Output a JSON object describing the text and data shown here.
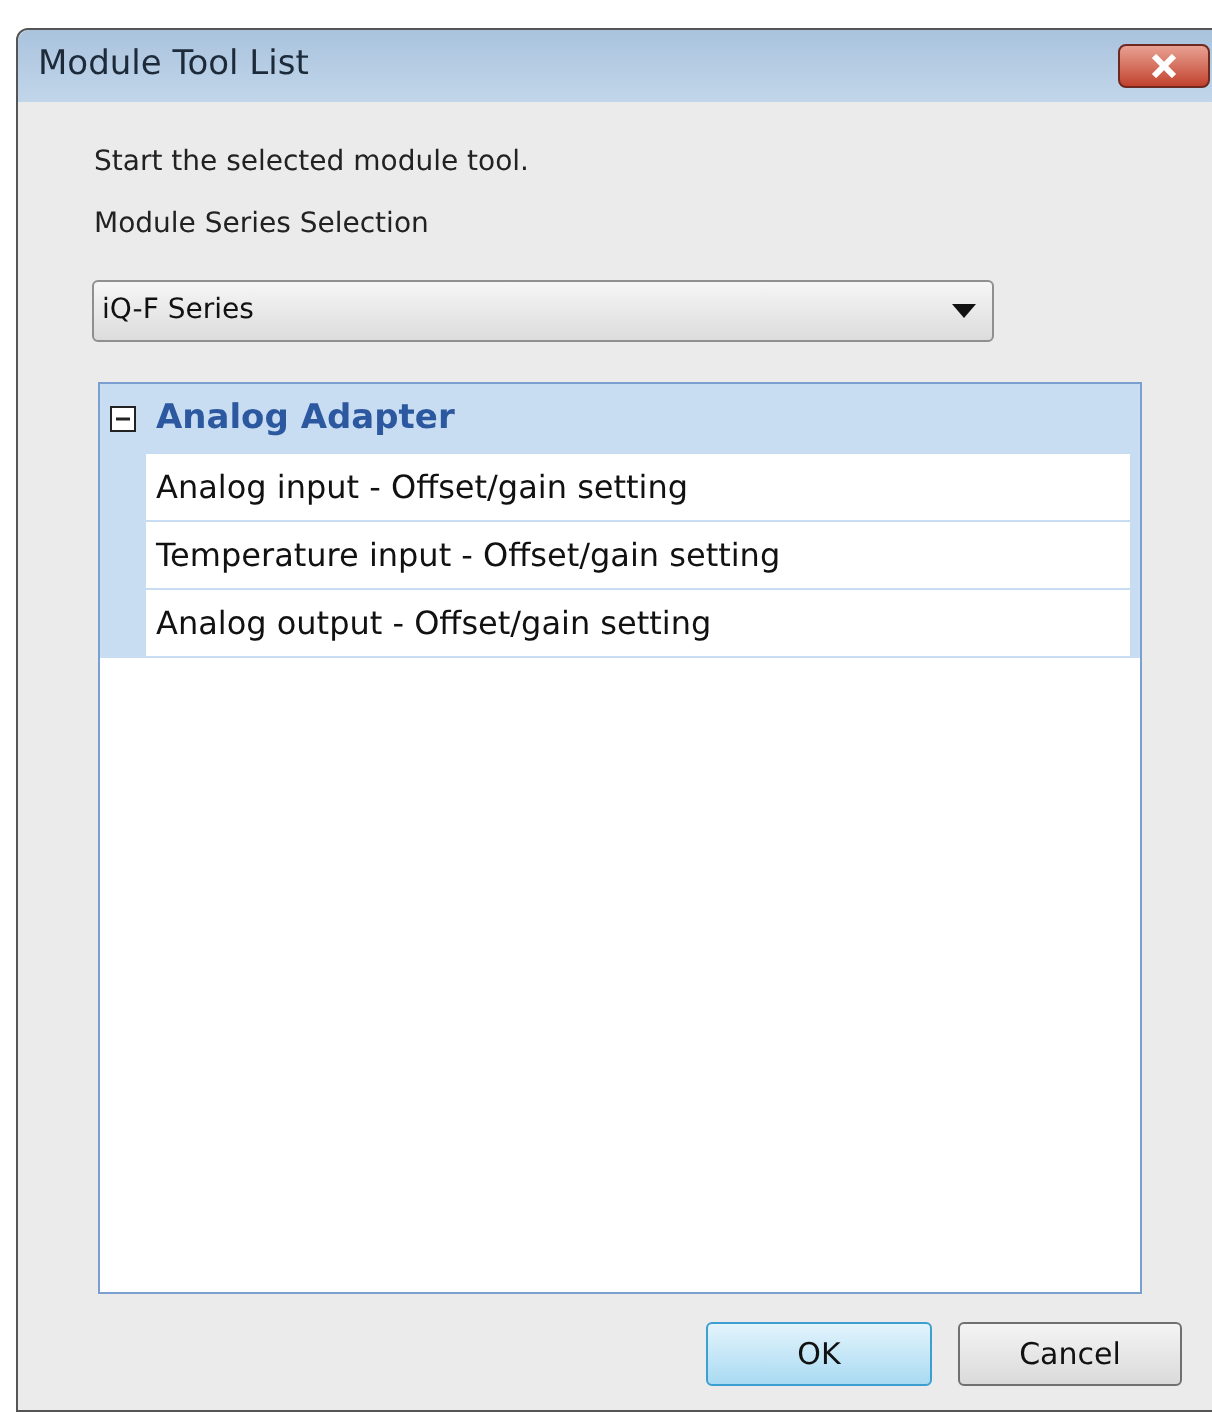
{
  "window": {
    "title": "Module Tool List"
  },
  "instruction": "Start the selected module tool.",
  "series_label": "Module Series Selection",
  "series_dropdown": {
    "value": "iQ-F Series"
  },
  "tree": [
    {
      "label": "Analog Adapter",
      "expanded": true,
      "children": [
        {
          "label": "Analog input - Offset/gain setting"
        },
        {
          "label": "Temperature input - Offset/gain setting"
        },
        {
          "label": "Analog output - Offset/gain setting"
        }
      ]
    }
  ],
  "buttons": [
    {
      "label": "OK",
      "kind": "default"
    },
    {
      "label": "Cancel",
      "kind": "normal"
    }
  ]
}
